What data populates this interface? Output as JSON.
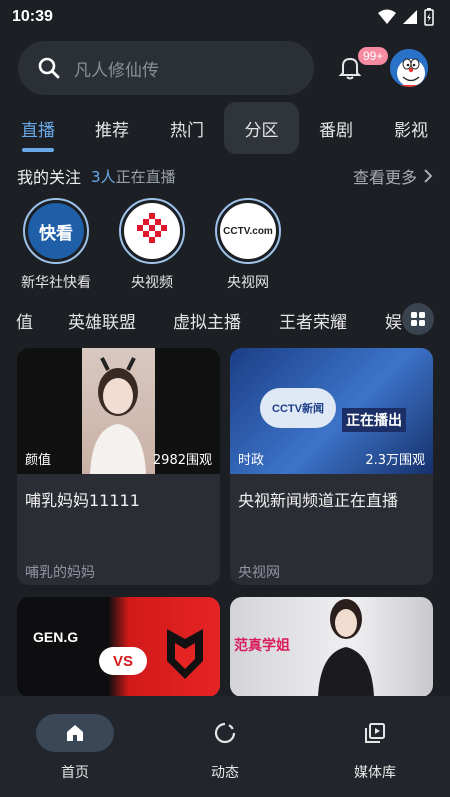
{
  "status": {
    "time": "10:39"
  },
  "search": {
    "placeholder": "凡人修仙传"
  },
  "notifications": {
    "badge": "99+"
  },
  "tabs": [
    {
      "label": "直播",
      "state": "active"
    },
    {
      "label": "推荐"
    },
    {
      "label": "热门"
    },
    {
      "label": "分区",
      "state": "highlight"
    },
    {
      "label": "番剧"
    },
    {
      "label": "影视"
    }
  ],
  "following": {
    "title": "我的关注",
    "count_num": "3人",
    "count_text": "正在直播",
    "more": "查看更多"
  },
  "channels": [
    {
      "name": "新华社快看",
      "logo_text": "快看"
    },
    {
      "name": "央视频",
      "logo_text": ""
    },
    {
      "name": "央视网",
      "logo_text": "CCTV.com"
    }
  ],
  "categories": [
    "值",
    "英雄联盟",
    "虚拟主播",
    "王者荣耀",
    "娱"
  ],
  "cards": [
    {
      "tag": "颜值",
      "views": "2982围观",
      "title": "哺乳妈妈11111",
      "owner": "哺乳的妈妈"
    },
    {
      "tag": "时政",
      "views": "2.3万围观",
      "title": "央视新闻频道正在直播",
      "owner": "央视网",
      "thumb_text": "正在播出",
      "logo_text": "CCTV新闻"
    },
    {
      "tag": "",
      "views": "",
      "title": "",
      "owner": "",
      "thumb_text": "GEN.G"
    },
    {
      "tag": "",
      "views": "",
      "title": "",
      "owner": "",
      "thumb_text": "范真学姐"
    }
  ],
  "nav": [
    {
      "label": "首页",
      "icon": "home-icon",
      "active": true
    },
    {
      "label": "动态",
      "icon": "activity-icon"
    },
    {
      "label": "媒体库",
      "icon": "library-icon"
    }
  ],
  "colors": {
    "accent": "#6aa9e8",
    "background": "#1c1f24",
    "badge": "#f58aa0"
  }
}
